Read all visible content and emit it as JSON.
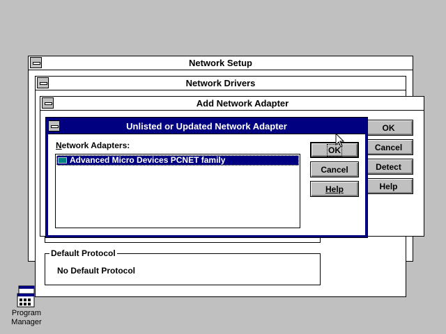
{
  "network_setup": {
    "title": "Network Setup",
    "default_protocol": {
      "legend": "Default Protocol",
      "value": "No Default Protocol"
    }
  },
  "network_drivers": {
    "title": "Network Drivers"
  },
  "add_adapter": {
    "title": "Add Network Adapter",
    "buttons": {
      "ok": "OK",
      "cancel": "Cancel",
      "detect": "Detect",
      "help": "Help"
    }
  },
  "unlisted": {
    "title": "Unlisted or Updated Network Adapter",
    "list_label_accel": "N",
    "list_label_rest": "etwork Adapters:",
    "adapters": [
      {
        "name": "Advanced Micro Devices PCNET family",
        "selected": true
      }
    ],
    "buttons": {
      "ok": "OK",
      "cancel": "Cancel",
      "help": "Help"
    }
  },
  "desktop": {
    "program_manager": {
      "label_line1": "Program",
      "label_line2": "Manager"
    }
  },
  "colors": {
    "desktop": "#c0c0c0",
    "active_title": "#000080",
    "selection": "#000080"
  }
}
